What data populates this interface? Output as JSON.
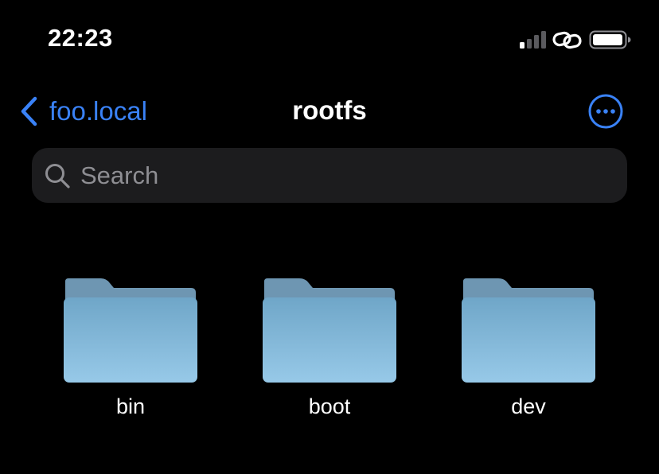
{
  "status_bar": {
    "time": "22:23",
    "signal_icon": "cellular-signal-icon",
    "link_icon": "personal-hotspot-link-icon",
    "battery_icon": "battery-icon"
  },
  "nav": {
    "back_icon": "chevron-left-icon",
    "back_label": "foo.local",
    "title": "rootfs",
    "more_icon": "ellipsis-circle-icon"
  },
  "search": {
    "icon": "magnifying-glass-icon",
    "placeholder": "Search",
    "value": ""
  },
  "folders": [
    {
      "name": "bin",
      "icon": "folder-icon"
    },
    {
      "name": "boot",
      "icon": "folder-icon"
    },
    {
      "name": "dev",
      "icon": "folder-icon"
    }
  ],
  "colors": {
    "background": "#000000",
    "accent": "#3a82f7",
    "search_field": "#1c1c1e",
    "placeholder": "#8e8e93",
    "folder_back": "#6e96b2",
    "folder_front_top": "#6fa6c8",
    "folder_front_bottom": "#97c9e8"
  }
}
